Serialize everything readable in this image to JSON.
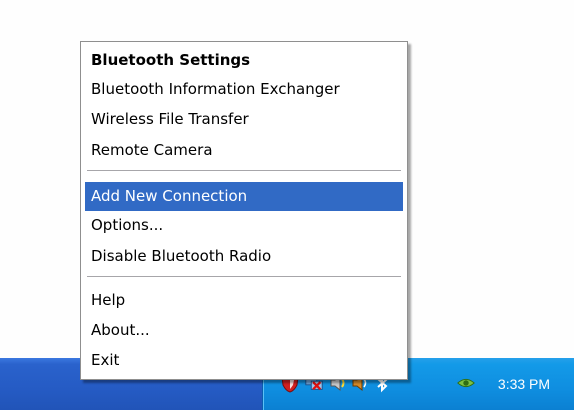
{
  "menu": {
    "items": [
      {
        "label": "Bluetooth Settings"
      },
      {
        "label": "Bluetooth Information Exchanger"
      },
      {
        "label": "Wireless File Transfer"
      },
      {
        "label": "Remote Camera"
      },
      {
        "label": "Add New Connection"
      },
      {
        "label": "Options..."
      },
      {
        "label": "Disable Bluetooth Radio"
      },
      {
        "label": "Help"
      },
      {
        "label": "About..."
      },
      {
        "label": "Exit"
      }
    ],
    "selected_label": "Add New Connection"
  },
  "taskbar": {
    "clock": "3:33 PM",
    "tray_icons": [
      "shield-icon",
      "network-disconnected-icon",
      "speaker-icon",
      "speaker-volume-icon",
      "bluetooth-icon",
      "display-icon"
    ]
  },
  "colors": {
    "selection": "#316ac5",
    "taskbar": "#255bc4",
    "tray": "#0f8ee0"
  }
}
